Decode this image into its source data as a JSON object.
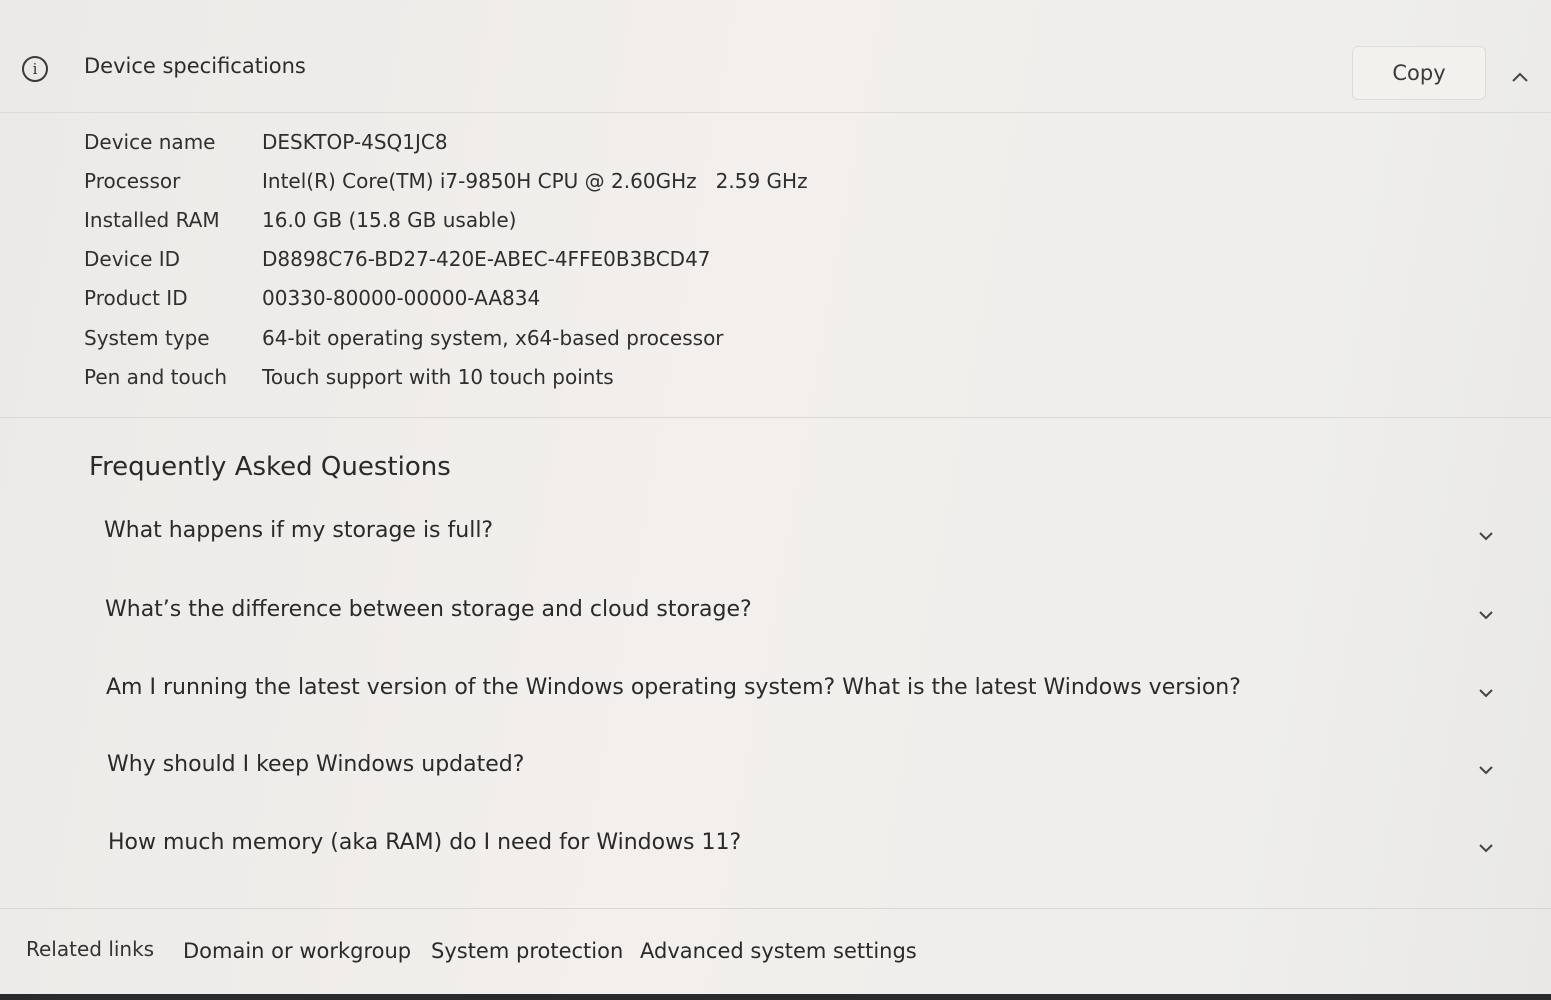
{
  "header": {
    "title": "Device specifications",
    "info_icon": "info-icon",
    "copy_label": "Copy",
    "collapse_icon": "chevron-up-icon"
  },
  "specs": [
    {
      "label": "Device name",
      "value": "DESKTOP-4SQ1JC8"
    },
    {
      "label": "Processor",
      "value": "Intel(R) Core(TM) i7-9850H CPU @ 2.60GHz   2.59 GHz"
    },
    {
      "label": "Installed RAM",
      "value": "16.0 GB (15.8 GB usable)"
    },
    {
      "label": "Device ID",
      "value": "D8898C76-BD27-420E-ABEC-4FFE0B3BCD47"
    },
    {
      "label": "Product ID",
      "value": "00330-80000-00000-AA834"
    },
    {
      "label": "System type",
      "value": "64-bit operating system, x64-based processor"
    },
    {
      "label": "Pen and touch",
      "value": "Touch support with 10 touch points"
    }
  ],
  "faq": {
    "title": "Frequently Asked Questions",
    "expand_icon": "chevron-down-icon",
    "items": [
      {
        "question": "What happens if my storage is full?"
      },
      {
        "question": "What’s the difference between storage and cloud storage?"
      },
      {
        "question": "Am I running the latest version of the Windows operating system? What is the latest Windows version?"
      },
      {
        "question": "Why should I keep Windows updated?"
      },
      {
        "question": "How much memory (aka RAM) do I need for Windows 11?"
      }
    ]
  },
  "related": {
    "label": "Related links",
    "links": [
      "Domain or workgroup",
      "System protection",
      "Advanced system settings"
    ]
  }
}
